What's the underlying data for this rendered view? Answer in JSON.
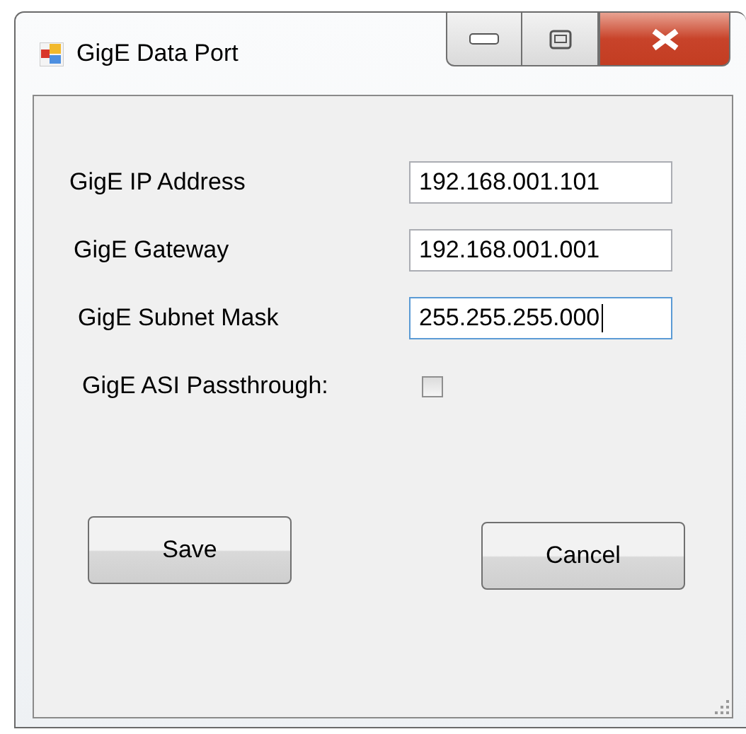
{
  "window": {
    "title": "GigE Data Port"
  },
  "fields": [
    {
      "kind": "text",
      "label": "GigE IP Address",
      "value": "192.168.001.101",
      "focused": false
    },
    {
      "kind": "text",
      "label": "GigE Gateway",
      "value": "192.168.001.001",
      "focused": false
    },
    {
      "kind": "text",
      "label": "GigE Subnet Mask",
      "value": "255.255.255.000",
      "focused": true
    },
    {
      "kind": "checkbox",
      "label": "GigE ASI Passthrough:",
      "checked": false
    }
  ],
  "buttons": [
    "Save",
    "Cancel"
  ]
}
